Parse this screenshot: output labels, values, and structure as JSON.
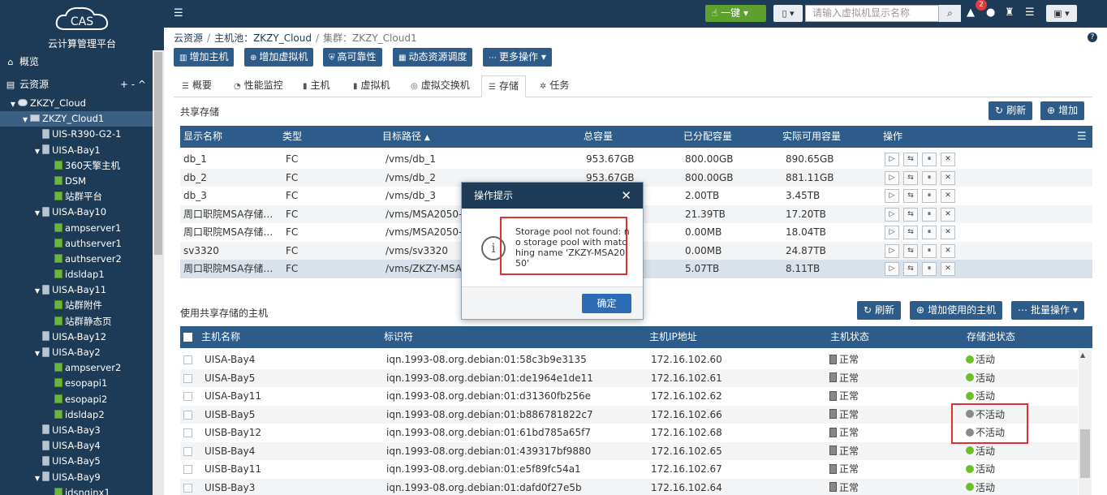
{
  "app": {
    "name": "云计算管理平台",
    "logo_text": "CAS"
  },
  "sidebar": {
    "overview": "概览",
    "cloud_resources": "云资源",
    "cloud_ctrl": "+ - ^",
    "tree": [
      {
        "label": "ZKZY_Cloud",
        "level": 0,
        "twisty": "▼",
        "icon": "cloud"
      },
      {
        "label": "ZKZY_Cloud1",
        "level": 1,
        "twisty": "▼",
        "icon": "cluster",
        "selected": true
      },
      {
        "label": "UIS-R390-G2-1",
        "level": 2,
        "twisty": "",
        "icon": "host"
      },
      {
        "label": "UISA-Bay1",
        "level": 2,
        "twisty": "▼",
        "icon": "host"
      },
      {
        "label": "360天擎主机",
        "level": 3,
        "twisty": "",
        "icon": "vm"
      },
      {
        "label": "DSM",
        "level": 3,
        "twisty": "",
        "icon": "vm"
      },
      {
        "label": "站群平台",
        "level": 3,
        "twisty": "",
        "icon": "vm"
      },
      {
        "label": "UISA-Bay10",
        "level": 2,
        "twisty": "▼",
        "icon": "host"
      },
      {
        "label": "ampserver1",
        "level": 3,
        "twisty": "",
        "icon": "vm"
      },
      {
        "label": "authserver1",
        "level": 3,
        "twisty": "",
        "icon": "vm"
      },
      {
        "label": "authserver2",
        "level": 3,
        "twisty": "",
        "icon": "vm"
      },
      {
        "label": "idsldap1",
        "level": 3,
        "twisty": "",
        "icon": "vm"
      },
      {
        "label": "UISA-Bay11",
        "level": 2,
        "twisty": "▼",
        "icon": "host"
      },
      {
        "label": "站群附件",
        "level": 3,
        "twisty": "",
        "icon": "vm"
      },
      {
        "label": "站群静态页",
        "level": 3,
        "twisty": "",
        "icon": "vm"
      },
      {
        "label": "UISA-Bay12",
        "level": 2,
        "twisty": "",
        "icon": "host"
      },
      {
        "label": "UISA-Bay2",
        "level": 2,
        "twisty": "▼",
        "icon": "host"
      },
      {
        "label": "ampserver2",
        "level": 3,
        "twisty": "",
        "icon": "vm"
      },
      {
        "label": "esopapi1",
        "level": 3,
        "twisty": "",
        "icon": "vm"
      },
      {
        "label": "esopapi2",
        "level": 3,
        "twisty": "",
        "icon": "vm"
      },
      {
        "label": "idsldap2",
        "level": 3,
        "twisty": "",
        "icon": "vm"
      },
      {
        "label": "UISA-Bay3",
        "level": 2,
        "twisty": "",
        "icon": "host"
      },
      {
        "label": "UISA-Bay4",
        "level": 2,
        "twisty": "",
        "icon": "host"
      },
      {
        "label": "UISA-Bay5",
        "level": 2,
        "twisty": "",
        "icon": "host"
      },
      {
        "label": "UISA-Bay9",
        "level": 2,
        "twisty": "▼",
        "icon": "host"
      },
      {
        "label": "idsnginx1",
        "level": 3,
        "twisty": "",
        "icon": "vm"
      }
    ]
  },
  "topbar": {
    "onekey": "一键",
    "search_placeholder": "请输入虚拟机显示名称",
    "alert_count": "2"
  },
  "breadcrumb": {
    "root": "云资源",
    "pool": "主机池：ZKZY_Cloud",
    "cluster": "集群：ZKZY_Cloud1"
  },
  "actions": [
    "增加主机",
    "增加虚拟机",
    "高可靠性",
    "动态资源调度",
    "更多操作"
  ],
  "tabs": [
    "概要",
    "性能监控",
    "主机",
    "虚拟机",
    "虚拟交换机",
    "存储",
    "任务"
  ],
  "shared_storage": {
    "title": "共享存储",
    "refresh": "刷新",
    "add": "增加",
    "columns": [
      "显示名称",
      "类型",
      "目标路径",
      "总容量",
      "已分配容量",
      "实际可用容量",
      "操作"
    ],
    "sort_marker": "▲",
    "rows": [
      [
        "db_1",
        "FC",
        "/vms/db_1",
        "953.67GB",
        "800.00GB",
        "890.65GB"
      ],
      [
        "db_2",
        "FC",
        "/vms/db_2",
        "953.67GB",
        "800.00GB",
        "881.11GB"
      ],
      [
        "db_3",
        "FC",
        "/vms/db_3",
        "",
        "2.00TB",
        "3.45TB"
      ],
      [
        "周口职院MSA存储…",
        "FC",
        "/vms/MSA2050-P",
        "",
        "21.39TB",
        "17.20TB"
      ],
      [
        "周口职院MSA存储…",
        "FC",
        "/vms/MSA2050-P",
        "",
        "0.00MB",
        "18.04TB"
      ],
      [
        "sv3320",
        "FC",
        "/vms/sv3320",
        "",
        "0.00MB",
        "24.87TB"
      ],
      [
        "周口职院MSA存储…",
        "FC",
        "/vms/ZKZY-MSA2",
        "",
        "5.07TB",
        "8.11TB"
      ]
    ]
  },
  "hosts_using": {
    "title": "使用共享存储的主机",
    "refresh": "刷新",
    "add_host": "增加使用的主机",
    "batch": "批量操作",
    "columns": [
      "主机名称",
      "标识符",
      "主机IP地址",
      "主机状态",
      "存储池状态"
    ],
    "rows": [
      {
        "name": "UISA-Bay4",
        "iqn": "iqn.1993-08.org.debian:01:58c3b9e3135",
        "ip": "172.16.102.60",
        "state": "正常",
        "pool": "活动",
        "pool_color": "#6cbf2a"
      },
      {
        "name": "UISA-Bay5",
        "iqn": "iqn.1993-08.org.debian:01:de1964e1de11",
        "ip": "172.16.102.61",
        "state": "正常",
        "pool": "活动",
        "pool_color": "#6cbf2a"
      },
      {
        "name": "UISA-Bay11",
        "iqn": "iqn.1993-08.org.debian:01:d31360fb256e",
        "ip": "172.16.102.62",
        "state": "正常",
        "pool": "活动",
        "pool_color": "#6cbf2a"
      },
      {
        "name": "UISB-Bay5",
        "iqn": "iqn.1993-08.org.debian:01:b886781822c7",
        "ip": "172.16.102.66",
        "state": "正常",
        "pool": "不活动",
        "pool_color": "#8a8a8a"
      },
      {
        "name": "UISB-Bay12",
        "iqn": "iqn.1993-08.org.debian:01:61bd785a65f7",
        "ip": "172.16.102.68",
        "state": "正常",
        "pool": "不活动",
        "pool_color": "#8a8a8a"
      },
      {
        "name": "UISB-Bay4",
        "iqn": "iqn.1993-08.org.debian:01:439317bf9880",
        "ip": "172.16.102.65",
        "state": "正常",
        "pool": "活动",
        "pool_color": "#6cbf2a"
      },
      {
        "name": "UISB-Bay11",
        "iqn": "iqn.1993-08.org.debian:01:e5f89fc54a1",
        "ip": "172.16.102.67",
        "state": "正常",
        "pool": "活动",
        "pool_color": "#6cbf2a"
      },
      {
        "name": "UISB-Bay3",
        "iqn": "iqn.1993-08.org.debian:01:dafd0f27e5b",
        "ip": "172.16.102.64",
        "state": "正常",
        "pool": "活动",
        "pool_color": "#6cbf2a"
      }
    ]
  },
  "dialog": {
    "title": "操作提示",
    "message": "Storage pool not found: no storage pool with matching name 'ZKZY-MSA2050'",
    "ok": "确定"
  },
  "colors": {
    "nav": "#1d3a56",
    "button": "#2d5c8a",
    "accent_green": "#5ea02e",
    "highlight": "#e03030"
  }
}
